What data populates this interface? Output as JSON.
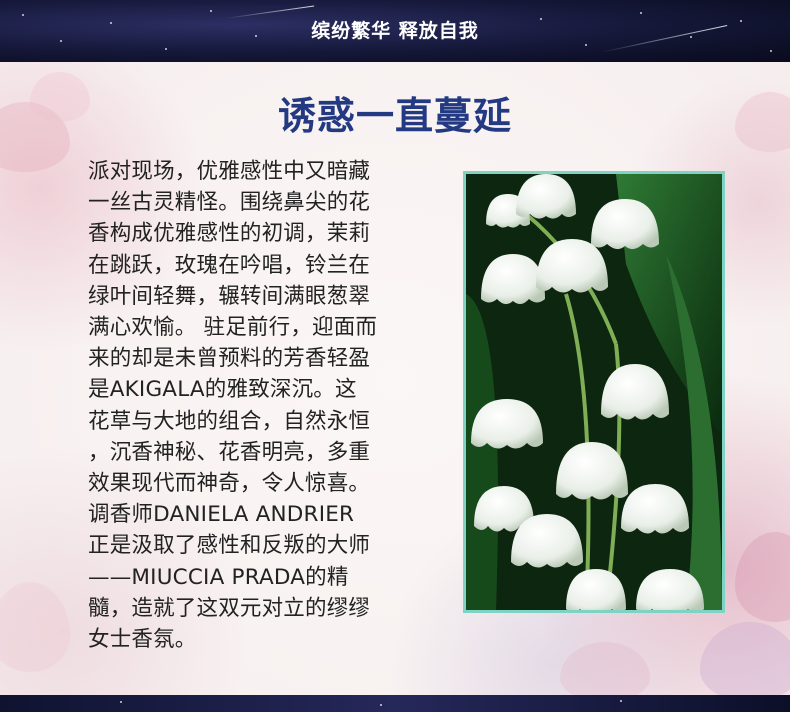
{
  "banner": {
    "title": "缤纷繁华 释放自我"
  },
  "section": {
    "title": "诱惑一直蔓延",
    "paragraph_lines": [
      "派对现场，优雅感性中又暗藏",
      "一丝古灵精怪。围绕鼻尖的花",
      "香构成优雅感性的初调，茉莉",
      "在跳跃，玫瑰在吟唱，铃兰在",
      "绿叶间轻舞，辗转间满眼葱翠",
      "满心欢愉。 驻足前行，迎面而",
      "来的却是未曾预料的芳香轻盈",
      "是AKIGALA的雅致深沉。这",
      "花草与大地的组合，自然永恒",
      "，沉香神秘、花香明亮，多重",
      "效果现代而神奇，令人惊喜。",
      "调香师DANIELA ANDRIER",
      "正是汲取了感性和反叛的大师",
      "——MIUCCIA PRADA的精",
      "髓，造就了这双元对立的缪缪",
      "女士香氛。"
    ]
  },
  "colors": {
    "title": "#233a82",
    "banner_text": "#ffffff",
    "photo_border": "#7fd3c4",
    "body_text": "#222222"
  }
}
